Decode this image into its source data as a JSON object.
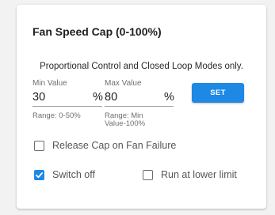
{
  "card": {
    "title": "Fan Speed Cap (0-100%)",
    "subtitle": "Proportional Control and Closed Loop Modes only."
  },
  "min_field": {
    "label": "Min Value",
    "value": "30",
    "unit": "%",
    "hint_line1": "Range: 0-50%"
  },
  "max_field": {
    "label": "Max Value",
    "value": "80",
    "unit": "%",
    "hint_line1": "Range: Min",
    "hint_line2": "Value-100%"
  },
  "set_button": {
    "label": "SET",
    "color": "#1e88e5"
  },
  "options": {
    "release_cap": {
      "label": "Release Cap on Fan Failure",
      "checked": false
    },
    "switch_off": {
      "label": "Switch off",
      "checked": true
    },
    "run_lower": {
      "label": "Run at lower limit",
      "checked": false
    }
  }
}
